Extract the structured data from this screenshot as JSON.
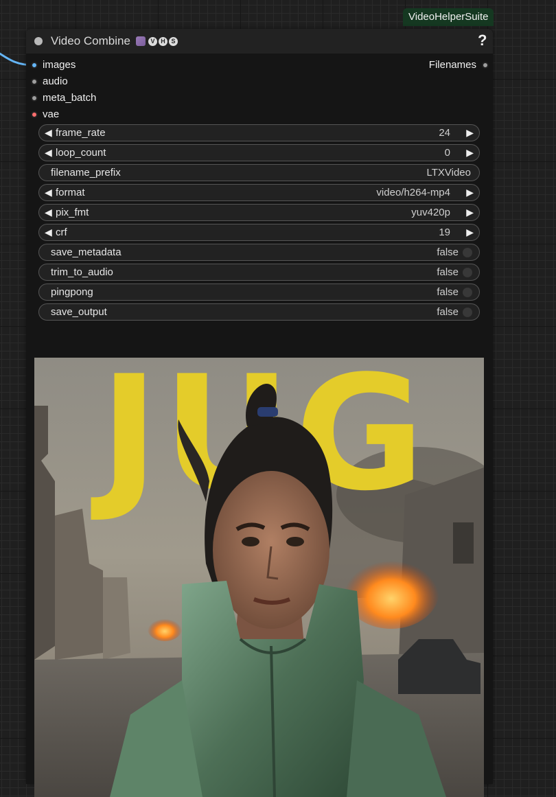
{
  "badge": {
    "label": "VideoHelperSuite"
  },
  "node": {
    "title": "Video Combine",
    "help_label": "?",
    "title_icons": [
      "movie-camera-emoji-icon",
      "letter-v-circle-icon",
      "letter-h-circle-icon",
      "letter-s-circle-icon"
    ],
    "title_icon_letters": [
      "V",
      "H",
      "S"
    ]
  },
  "inputs": [
    {
      "label": "images",
      "color": "#64b5f6"
    },
    {
      "label": "audio",
      "color": "#9e9e9e"
    },
    {
      "label": "meta_batch",
      "color": "#9e9e9e"
    },
    {
      "label": "vae",
      "color": "#ff6e6e"
    }
  ],
  "outputs": [
    {
      "label": "Filenames",
      "color": "#9e9e9e"
    }
  ],
  "widgets": {
    "frame_rate": {
      "label": "frame_rate",
      "value": "24"
    },
    "loop_count": {
      "label": "loop_count",
      "value": "0"
    },
    "filename_prefix": {
      "label": "filename_prefix",
      "value": "LTXVideo"
    },
    "format": {
      "label": "format",
      "value": "video/h264-mp4"
    },
    "pix_fmt": {
      "label": "pix_fmt",
      "value": "yuv420p"
    },
    "crf": {
      "label": "crf",
      "value": "19"
    },
    "save_metadata": {
      "label": "save_metadata",
      "value": "false"
    },
    "trim_to_audio": {
      "label": "trim_to_audio",
      "value": "false"
    },
    "pingpong": {
      "label": "pingpong",
      "value": "false"
    },
    "save_output": {
      "label": "save_output",
      "value": "false"
    }
  },
  "preview": {
    "text": "JUG"
  },
  "colors": {
    "link": "#64b5f6",
    "badge_bg": "#153821",
    "accent_yellow": "#e4cc2a"
  }
}
